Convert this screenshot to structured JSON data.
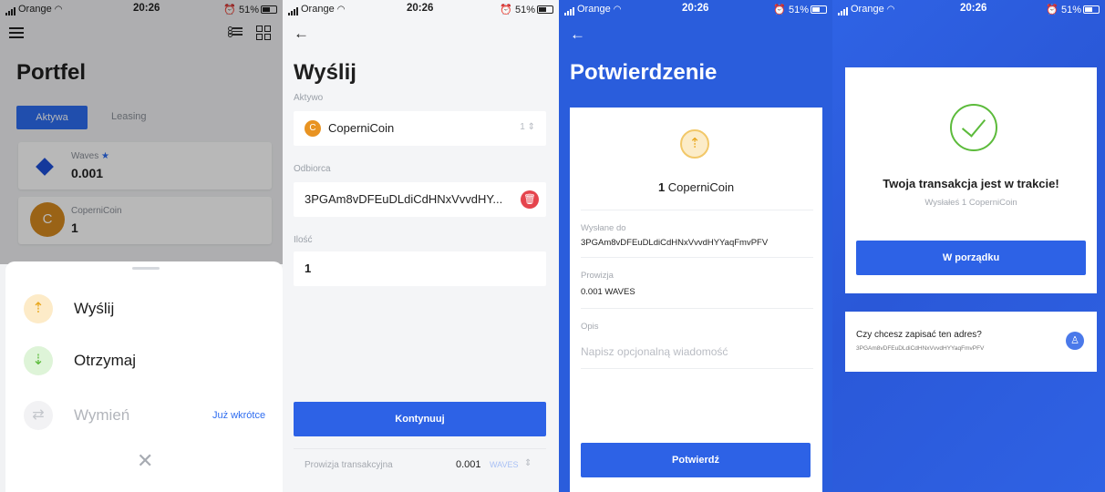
{
  "status": {
    "carrier": "Orange",
    "time": "20:26",
    "battery": "51%"
  },
  "screen1": {
    "title": "Portfel",
    "tabs": [
      "Aktywa",
      "Leasing"
    ],
    "assets": [
      {
        "name": "Waves",
        "value": "0.001",
        "icon": "waves-diamond-icon"
      },
      {
        "name": "CoperniCoin",
        "value": "1",
        "icon_letter": "C"
      }
    ],
    "menu": {
      "send": "Wyślij",
      "receive": "Otrzymaj",
      "exchange": "Wymień",
      "soon": "Już wkrótce"
    }
  },
  "screen2": {
    "title": "Wyślij",
    "asset_label": "Aktywo",
    "asset_value": "CoperniCoin",
    "asset_letter": "C",
    "asset_balance": "1",
    "recipient_label": "Odbiorca",
    "recipient_value": "3PGAm8vDFEuDLdiCdHNxVvvdHY...",
    "amount_label": "Ilość",
    "amount_value": "1",
    "continue_btn": "Kontynuuj",
    "fee_label": "Prowizja transakcyjna",
    "fee_amount": "0.001",
    "fee_unit": "WAVES"
  },
  "screen3": {
    "title": "Potwierdzenie",
    "amount_num": "1",
    "amount_coin": "CoperniCoin",
    "sent_to_label": "Wysłane do",
    "sent_to_value": "3PGAm8vDFEuDLdiCdHNxVvvdHYYaqFmvPFV",
    "fee_label": "Prowizja",
    "fee_value": "0.001 WAVES",
    "desc_label": "Opis",
    "desc_placeholder": "Napisz opcjonalną wiadomość",
    "confirm_btn": "Potwierdź"
  },
  "screen4": {
    "title": "Twoja transakcja jest w trakcie!",
    "subtitle": "Wysłałeś 1 CoperniCoin",
    "ok_btn": "W porządku",
    "save_question": "Czy chcesz zapisać ten adres?",
    "save_address": "3PGAm8vDFEuDLdiCdHNxVvvdHYYaqFmvPFV"
  },
  "colors": {
    "accent": "#2d62e6",
    "success": "#5cbb3b",
    "danger": "#e5444d",
    "coin": "#e89322"
  }
}
